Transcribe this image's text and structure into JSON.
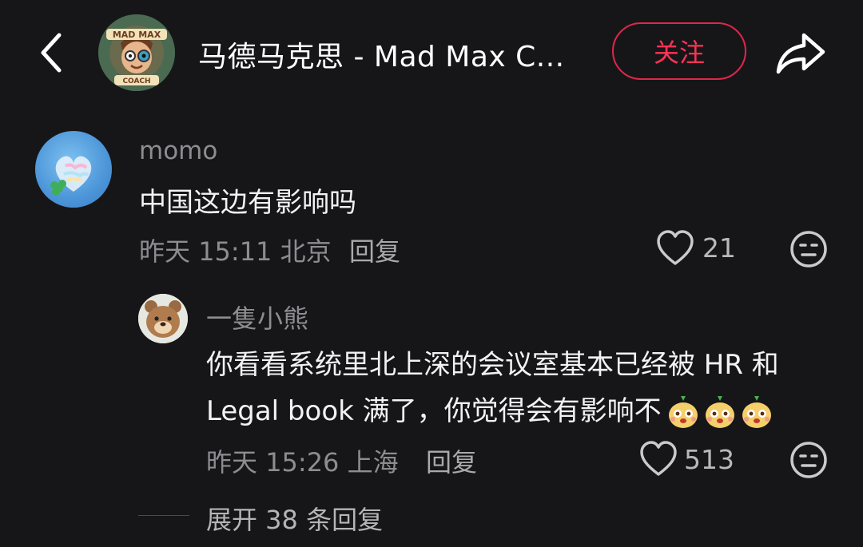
{
  "header": {
    "title": "马德马克思 - Mad Max C...",
    "follow_label": "关注",
    "avatar_badge_top": "MAD MAX",
    "avatar_badge_bottom": "COACH"
  },
  "comments": [
    {
      "username": "momo",
      "text": "中国这边有影响吗",
      "date": "昨天",
      "time": "15:11",
      "location": "北京",
      "reply_label": "回复",
      "likes": "21"
    },
    {
      "username": "一隻小熊",
      "text": "你看看系统里北上深的会议室基本已经被 HR 和 Legal book 满了，你觉得会有影响不",
      "date": "昨天",
      "time": "15:26",
      "location": "上海",
      "reply_label": "回复",
      "likes": "513"
    }
  ],
  "expand_label": "展开 38 条回复",
  "colors": {
    "background": "#161618",
    "accent": "#ff3356",
    "secondary_text": "#8c8c92"
  },
  "icons": [
    "chevron-left-icon",
    "share-icon",
    "heart-icon",
    "neutral-face-icon",
    "bear-emoji-icon"
  ]
}
